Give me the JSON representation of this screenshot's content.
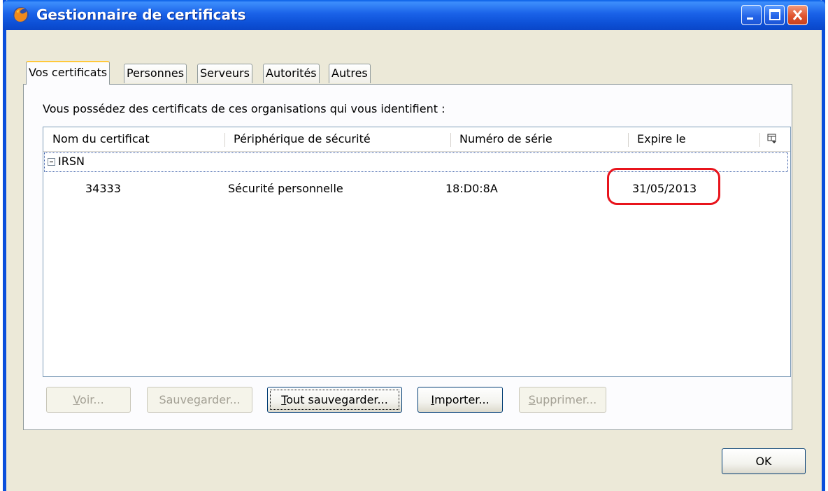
{
  "window": {
    "title": "Gestionnaire de certificats"
  },
  "tabs": [
    {
      "label": "Vos certificats",
      "active": true
    },
    {
      "label": "Personnes",
      "active": false
    },
    {
      "label": "Serveurs",
      "active": false
    },
    {
      "label": "Autorités",
      "active": false
    },
    {
      "label": "Autres",
      "active": false
    }
  ],
  "panel": {
    "intro": "Vous possédez des certificats de ces organisations qui vous identifient :",
    "columns": [
      "Nom du certificat",
      "Périphérique de sécurité",
      "Numéro de série",
      "Expire le"
    ],
    "group": {
      "name": "IRSN",
      "expanded": true
    },
    "rows": [
      {
        "name": "34333",
        "device": "Sécurité personnelle",
        "serial": "18:D0:8A",
        "expires": "31/05/2013"
      }
    ]
  },
  "buttons": {
    "view": {
      "label_first": "V",
      "label_rest": "oir...",
      "enabled": false
    },
    "backup": {
      "label_before": "Sauve",
      "label_ul": "g",
      "label_after": "arder...",
      "enabled": false
    },
    "backup_all": {
      "label_first": "T",
      "label_rest": "out sauvegarder...",
      "enabled": true
    },
    "import": {
      "label_first": "I",
      "label_rest": "mporter...",
      "enabled": true
    },
    "delete": {
      "label_first": "S",
      "label_rest": "upprimer...",
      "enabled": false
    },
    "ok": {
      "label": "OK",
      "enabled": true
    }
  },
  "colors": {
    "titlebar": "#0a4fdc",
    "tab_highlight": "#ffc83c",
    "annotation": "#e8141c"
  }
}
